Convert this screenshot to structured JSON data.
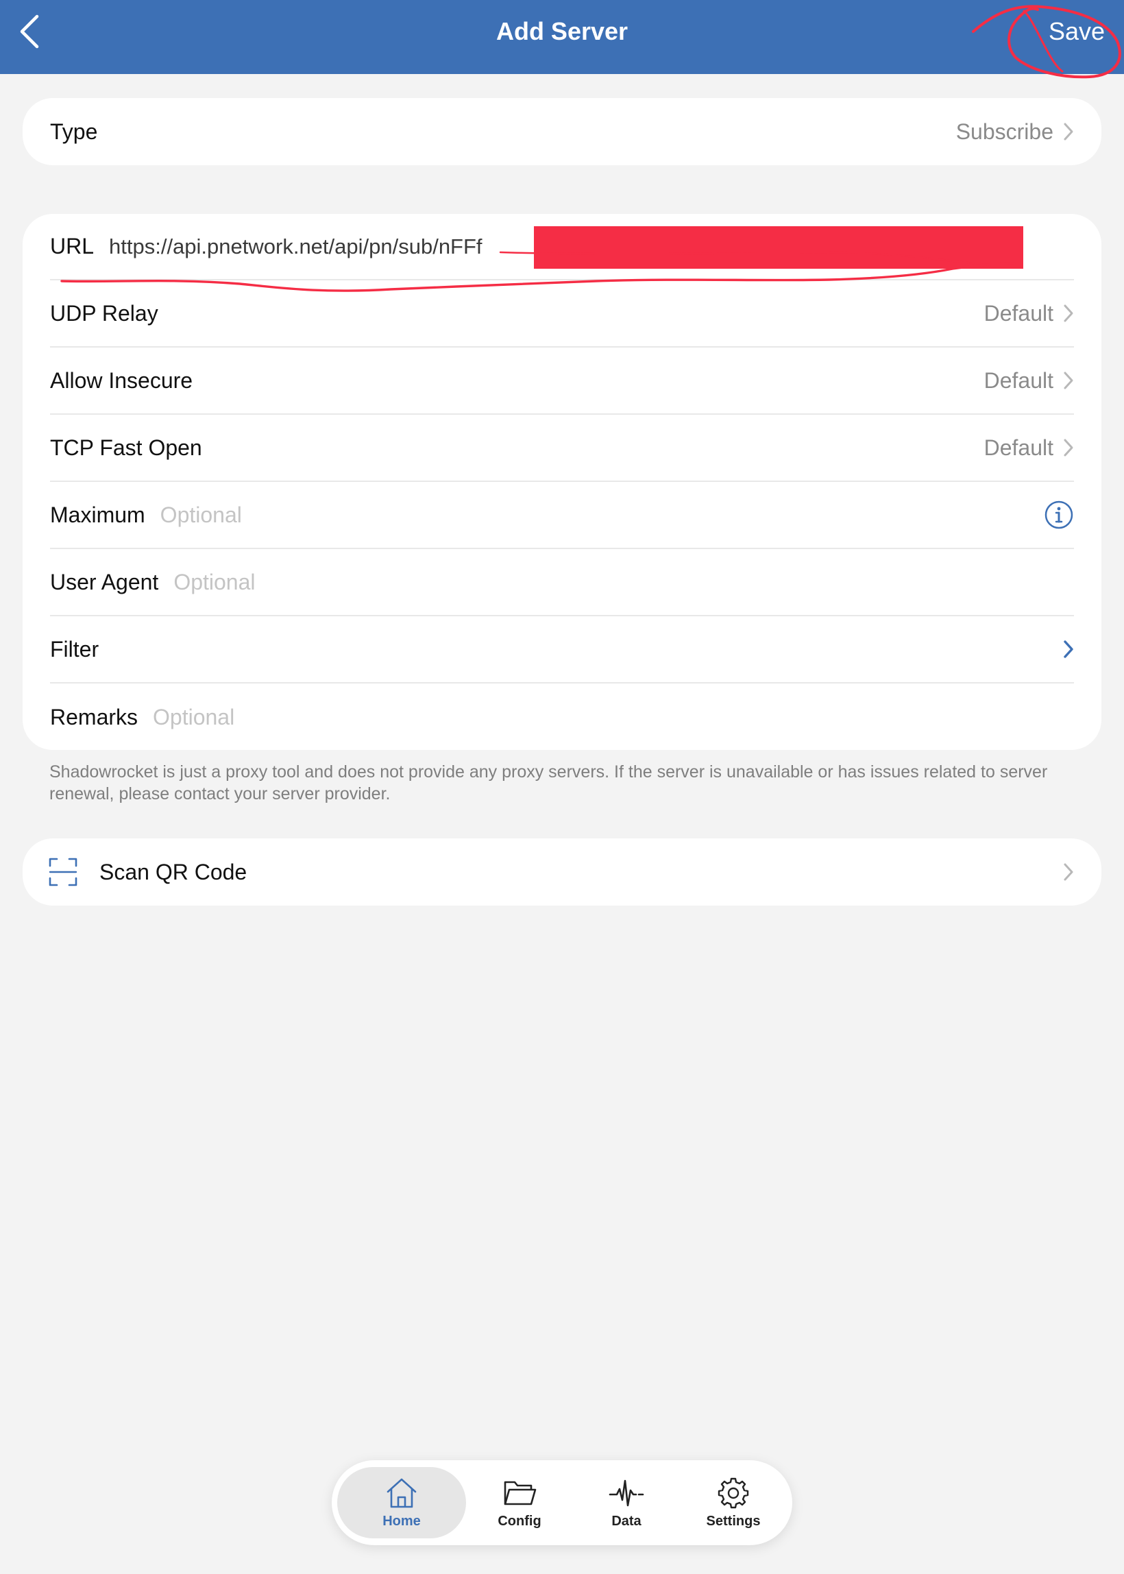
{
  "header": {
    "title": "Add Server",
    "save_label": "Save"
  },
  "type_row": {
    "label": "Type",
    "value": "Subscribe"
  },
  "form": {
    "url": {
      "label": "URL",
      "value": "https://api.pnetwork.net/api/pn/sub/nFFf"
    },
    "udp_relay": {
      "label": "UDP Relay",
      "value": "Default"
    },
    "allow_insecure": {
      "label": "Allow Insecure",
      "value": "Default"
    },
    "tcp_fast_open": {
      "label": "TCP Fast Open",
      "value": "Default"
    },
    "maximum": {
      "label": "Maximum",
      "placeholder": "Optional"
    },
    "user_agent": {
      "label": "User Agent",
      "placeholder": "Optional"
    },
    "filter": {
      "label": "Filter"
    },
    "remarks": {
      "label": "Remarks",
      "placeholder": "Optional"
    }
  },
  "footnote": "Shadowrocket is just a proxy tool and does not provide any proxy servers. If the server is unavailable or has issues related to server renewal, please contact your server provider.",
  "scan": {
    "label": "Scan QR Code"
  },
  "tabs": [
    {
      "label": "Home",
      "icon": "home-icon",
      "active": true
    },
    {
      "label": "Config",
      "icon": "folder-icon",
      "active": false
    },
    {
      "label": "Data",
      "icon": "pulse-icon",
      "active": false
    },
    {
      "label": "Settings",
      "icon": "gear-icon",
      "active": false
    }
  ],
  "colors": {
    "accent": "#3d70b5",
    "annotation_red": "#f52d45",
    "background": "#f3f3f3"
  }
}
